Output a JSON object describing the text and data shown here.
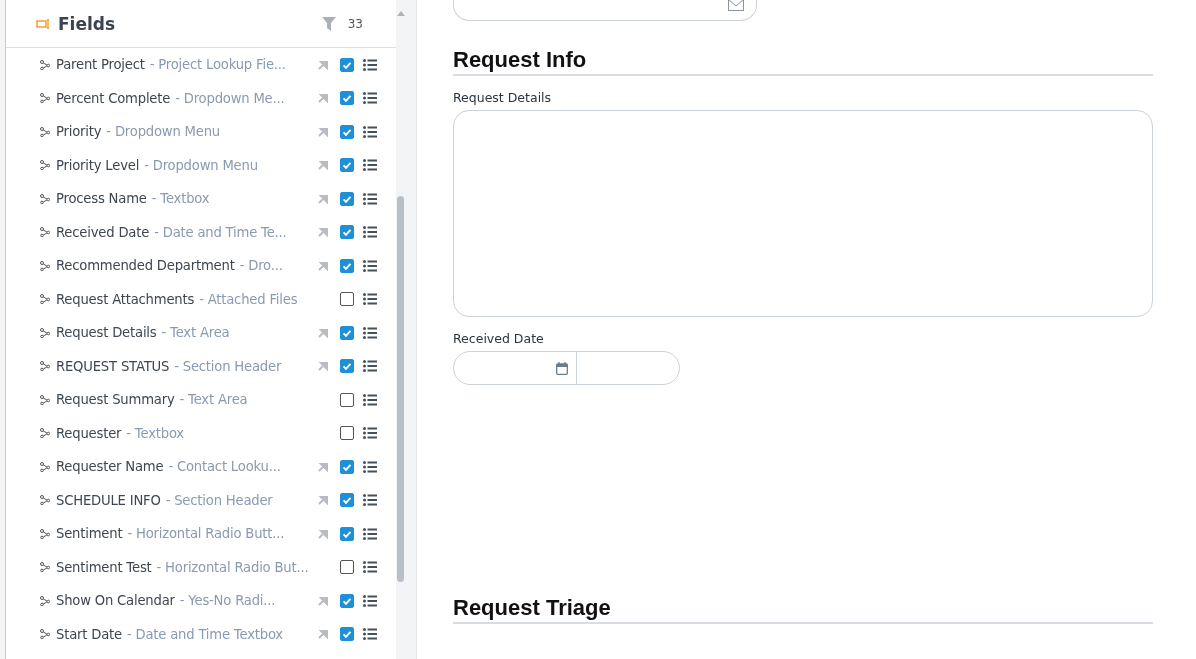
{
  "panel": {
    "title": "Fields",
    "count": "33"
  },
  "fields": [
    {
      "name": "Parent Project",
      "type": "- Project Lookup Fie...",
      "pinned": true,
      "checked": true
    },
    {
      "name": "Percent Complete",
      "type": "- Dropdown Me...",
      "pinned": true,
      "checked": true
    },
    {
      "name": "Priority",
      "type": "- Dropdown Menu",
      "pinned": true,
      "checked": true
    },
    {
      "name": "Priority Level",
      "type": "- Dropdown Menu",
      "pinned": true,
      "checked": true
    },
    {
      "name": "Process Name",
      "type": "- Textbox",
      "pinned": true,
      "checked": true
    },
    {
      "name": "Received Date",
      "type": "- Date and Time Te...",
      "pinned": true,
      "checked": true
    },
    {
      "name": "Recommended Department",
      "type": "- Dro...",
      "pinned": true,
      "checked": true
    },
    {
      "name": "Request Attachments",
      "type": "- Attached Files",
      "pinned": false,
      "checked": false
    },
    {
      "name": "Request Details",
      "type": "- Text Area",
      "pinned": true,
      "checked": true
    },
    {
      "name": "REQUEST STATUS",
      "type": "- Section Header",
      "pinned": true,
      "checked": true
    },
    {
      "name": "Request Summary",
      "type": "- Text Area",
      "pinned": false,
      "checked": false
    },
    {
      "name": "Requester",
      "type": "- Textbox",
      "pinned": false,
      "checked": false
    },
    {
      "name": "Requester Name",
      "type": "- Contact Looku...",
      "pinned": true,
      "checked": true
    },
    {
      "name": "SCHEDULE INFO",
      "type": "- Section Header",
      "pinned": true,
      "checked": true
    },
    {
      "name": "Sentiment",
      "type": "- Horizontal Radio Butt...",
      "pinned": true,
      "checked": true
    },
    {
      "name": "Sentiment Test",
      "type": "- Horizontal Radio But...",
      "pinned": false,
      "checked": false
    },
    {
      "name": "Show On Calendar",
      "type": "- Yes-No Radi...",
      "pinned": true,
      "checked": true
    },
    {
      "name": "Start Date",
      "type": "- Date and Time Textbox",
      "pinned": true,
      "checked": true
    }
  ],
  "form": {
    "sections": [
      {
        "title": "Request Info",
        "fields": [
          {
            "kind": "textarea",
            "label": "Request Details"
          },
          {
            "kind": "datetime",
            "label": "Received Date"
          }
        ]
      },
      {
        "title": "Request Triage"
      }
    ]
  }
}
